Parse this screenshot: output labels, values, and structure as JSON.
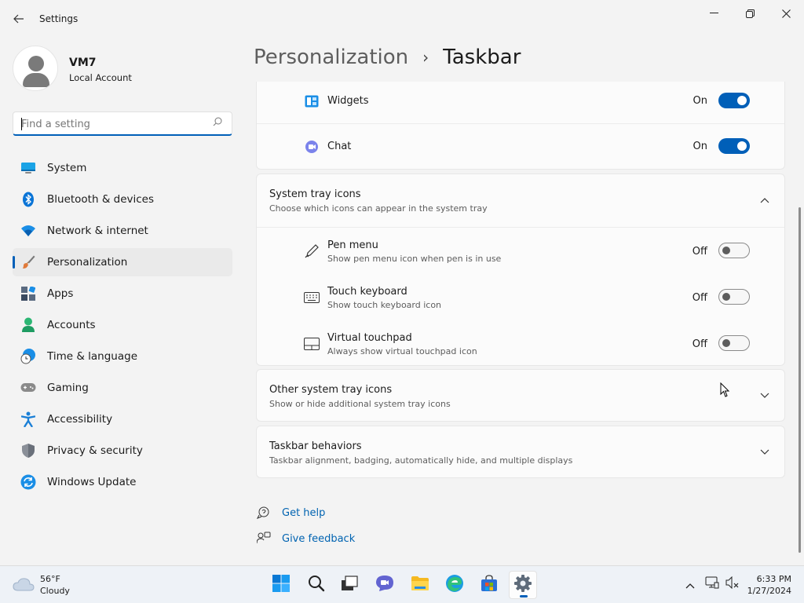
{
  "window": {
    "title": "Settings",
    "controls": {
      "minimize": "minimize",
      "maximize": "restore",
      "close": "close"
    }
  },
  "profile": {
    "name": "VM7",
    "account_type": "Local Account"
  },
  "search": {
    "placeholder": "Find a setting",
    "value": ""
  },
  "sidebar": {
    "items": [
      {
        "label": "System",
        "icon": "system-icon",
        "active": false
      },
      {
        "label": "Bluetooth & devices",
        "icon": "bluetooth-icon",
        "active": false
      },
      {
        "label": "Network & internet",
        "icon": "wifi-icon",
        "active": false
      },
      {
        "label": "Personalization",
        "icon": "brush-icon",
        "active": true
      },
      {
        "label": "Apps",
        "icon": "apps-icon",
        "active": false
      },
      {
        "label": "Accounts",
        "icon": "accounts-icon",
        "active": false
      },
      {
        "label": "Time & language",
        "icon": "globe-clock-icon",
        "active": false
      },
      {
        "label": "Gaming",
        "icon": "gamepad-icon",
        "active": false
      },
      {
        "label": "Accessibility",
        "icon": "accessibility-icon",
        "active": false
      },
      {
        "label": "Privacy & security",
        "icon": "shield-icon",
        "active": false
      },
      {
        "label": "Windows Update",
        "icon": "update-icon",
        "active": false
      }
    ]
  },
  "breadcrumb": {
    "parent": "Personalization",
    "separator": "›",
    "current": "Taskbar"
  },
  "taskbar_items": {
    "widgets": {
      "label": "Widgets",
      "state": "On",
      "on": true
    },
    "chat": {
      "label": "Chat",
      "state": "On",
      "on": true
    }
  },
  "system_tray": {
    "title": "System tray icons",
    "subtitle": "Choose which icons can appear in the system tray",
    "expanded": true,
    "items": [
      {
        "title": "Pen menu",
        "subtitle": "Show pen menu icon when pen is in use",
        "state": "Off",
        "on": false
      },
      {
        "title": "Touch keyboard",
        "subtitle": "Show touch keyboard icon",
        "state": "Off",
        "on": false
      },
      {
        "title": "Virtual touchpad",
        "subtitle": "Always show virtual touchpad icon",
        "state": "Off",
        "on": false
      }
    ]
  },
  "other_tray": {
    "title": "Other system tray icons",
    "subtitle": "Show or hide additional system tray icons"
  },
  "behaviors": {
    "title": "Taskbar behaviors",
    "subtitle": "Taskbar alignment, badging, automatically hide, and multiple displays"
  },
  "help": {
    "get_help": "Get help",
    "give_feedback": "Give feedback"
  },
  "taskbar": {
    "weather": {
      "temp": "56°F",
      "condition": "Cloudy"
    },
    "apps": [
      "start-icon",
      "search-icon",
      "task-view-icon",
      "chat-icon",
      "file-explorer-icon",
      "edge-icon",
      "store-icon",
      "settings-icon"
    ],
    "clock": {
      "time": "6:33 PM",
      "date": "1/27/2024"
    }
  },
  "colors": {
    "accent": "#005fb8",
    "link": "#0063b1",
    "background": "#f3f3f3",
    "card": "#fbfbfb"
  }
}
